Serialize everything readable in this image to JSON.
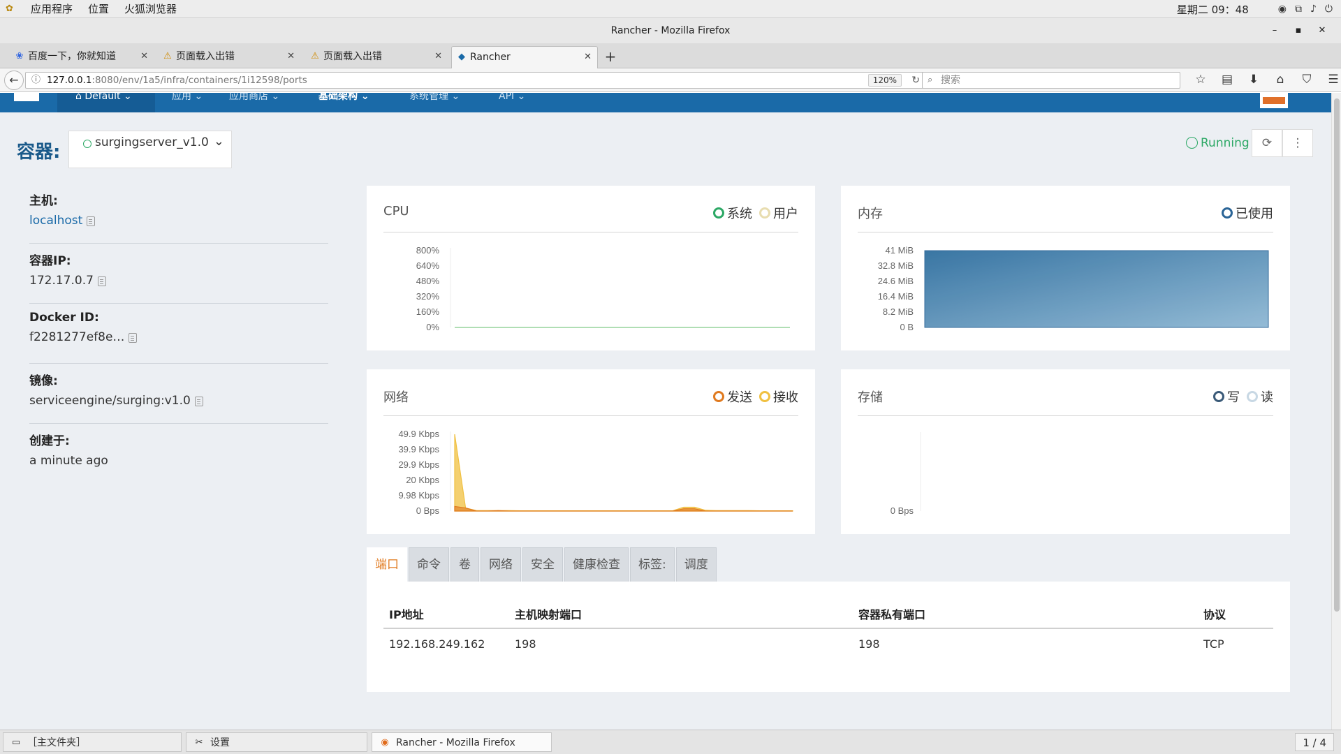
{
  "os_topbar": {
    "menus": [
      "应用程序",
      "位置",
      "火狐浏览器"
    ],
    "clock": "星期二 09：48"
  },
  "window": {
    "title": "Rancher - Mozilla Firefox"
  },
  "browser_tabs": [
    {
      "label": "百度一下，你就知道",
      "icon": "baidu-paw-icon"
    },
    {
      "label": "页面载入出错",
      "icon": "warning-icon"
    },
    {
      "label": "页面载入出错",
      "icon": "warning-icon"
    },
    {
      "label": "Rancher",
      "icon": "rancher-icon"
    }
  ],
  "address_bar": {
    "host": "127.0.0.1",
    "path": ":8080/env/1a5/infra/containers/1i12598/ports",
    "zoom": "120%",
    "search_placeholder": "搜索"
  },
  "rancher_nav": {
    "env": "Default",
    "items": [
      "应用",
      "应用商店",
      "基础架构",
      "系统管理",
      "API"
    ]
  },
  "header": {
    "label": "容器:",
    "container_name": "surgingserver_v1.0",
    "status": "Running"
  },
  "info": {
    "host_label": "主机:",
    "host_value": "localhost",
    "ip_label": "容器IP:",
    "ip_value": "172.17.0.7",
    "docker_label": "Docker ID:",
    "docker_value": "f2281277ef8e…",
    "image_label": "镜像:",
    "image_value": "serviceengine/surging:v1.0",
    "created_label": "创建于:",
    "created_value": "a minute ago"
  },
  "colors": {
    "system": "#2ca865",
    "user": "#e8ddb0",
    "used": "#2a6496",
    "send": "#e07a1f",
    "receive": "#f0c040",
    "write": "#3a5a78",
    "read": "#c8d8e4",
    "brand": "#1a6aa8"
  },
  "chart_data": [
    {
      "type": "line",
      "title": "CPU",
      "series": [
        {
          "name": "系统",
          "values": [
            0,
            0,
            0,
            0,
            0,
            0,
            0,
            0,
            0,
            0
          ]
        },
        {
          "name": "用户",
          "values": [
            0,
            0,
            0,
            0,
            0,
            0,
            0,
            0,
            0,
            0
          ]
        }
      ],
      "yticks": [
        "800%",
        "640%",
        "480%",
        "320%",
        "160%",
        "0%"
      ],
      "ylim": [
        0,
        800
      ]
    },
    {
      "type": "area",
      "title": "内存",
      "series": [
        {
          "name": "已使用",
          "values": [
            41,
            41,
            41,
            41,
            41,
            41,
            41,
            41
          ]
        }
      ],
      "yticks": [
        "41 MiB",
        "32.8 MiB",
        "24.6 MiB",
        "16.4 MiB",
        "8.2 MiB",
        "0 B"
      ],
      "ylim": [
        0,
        41
      ]
    },
    {
      "type": "area",
      "title": "网络",
      "series": [
        {
          "name": "发送",
          "values": [
            3,
            2,
            0,
            0,
            0.3,
            0,
            0,
            0,
            0,
            0,
            0,
            0,
            0,
            0,
            0,
            0,
            0,
            0,
            0,
            0,
            0,
            1.5,
            1.5,
            0,
            0,
            0,
            0,
            0,
            0,
            0,
            0,
            0
          ]
        },
        {
          "name": "接收",
          "values": [
            49.9,
            2,
            0.3,
            0.3,
            0.3,
            0.3,
            0.2,
            0.2,
            0.2,
            0.2,
            0.2,
            0.2,
            0.2,
            0.2,
            0.2,
            0.2,
            0.2,
            0.2,
            0.2,
            0.2,
            0.2,
            2.5,
            2.5,
            0.5,
            0.3,
            0.3,
            0.3,
            0.3,
            0.2,
            0.2,
            0.2,
            0.2
          ]
        }
      ],
      "yticks": [
        "49.9 Kbps",
        "39.9 Kbps",
        "29.9 Kbps",
        "20 Kbps",
        "9.98 Kbps",
        "0 Bps"
      ],
      "ylim": [
        0,
        49.9
      ]
    },
    {
      "type": "area",
      "title": "存储",
      "series": [
        {
          "name": "写",
          "values": []
        },
        {
          "name": "读",
          "values": []
        }
      ],
      "yticks": [
        "0 Bps"
      ],
      "ylim": [
        0,
        0
      ]
    }
  ],
  "detail_tabs": [
    "端口",
    "命令",
    "卷",
    "网络",
    "安全",
    "健康检查",
    "标签:",
    "调度"
  ],
  "ports_table": {
    "headers": [
      "IP地址",
      "主机映射端口",
      "容器私有端口",
      "协议"
    ],
    "rows": [
      [
        "192.168.249.162",
        "198",
        "198",
        "TCP"
      ]
    ]
  },
  "taskbar": {
    "items": [
      "［主文件夹］",
      "设置",
      "Rancher - Mozilla Firefox"
    ],
    "pager": "1 / 4"
  }
}
